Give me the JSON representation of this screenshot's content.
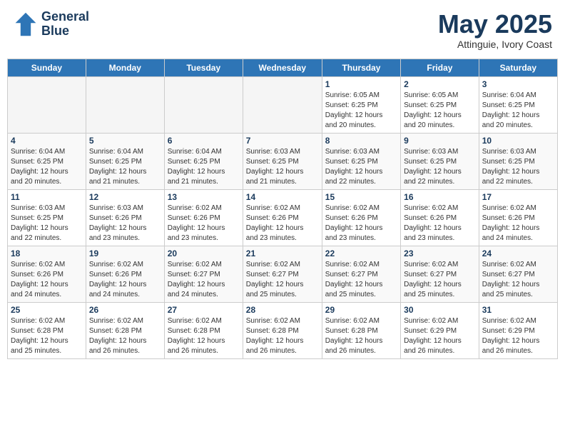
{
  "header": {
    "logo_line1": "General",
    "logo_line2": "Blue",
    "month_title": "May 2025",
    "subtitle": "Attinguie, Ivory Coast"
  },
  "weekdays": [
    "Sunday",
    "Monday",
    "Tuesday",
    "Wednesday",
    "Thursday",
    "Friday",
    "Saturday"
  ],
  "weeks": [
    [
      {
        "day": "",
        "empty": true
      },
      {
        "day": "",
        "empty": true
      },
      {
        "day": "",
        "empty": true
      },
      {
        "day": "",
        "empty": true
      },
      {
        "day": "1",
        "info": "Sunrise: 6:05 AM\nSunset: 6:25 PM\nDaylight: 12 hours\nand 20 minutes."
      },
      {
        "day": "2",
        "info": "Sunrise: 6:05 AM\nSunset: 6:25 PM\nDaylight: 12 hours\nand 20 minutes."
      },
      {
        "day": "3",
        "info": "Sunrise: 6:04 AM\nSunset: 6:25 PM\nDaylight: 12 hours\nand 20 minutes."
      }
    ],
    [
      {
        "day": "4",
        "info": "Sunrise: 6:04 AM\nSunset: 6:25 PM\nDaylight: 12 hours\nand 20 minutes."
      },
      {
        "day": "5",
        "info": "Sunrise: 6:04 AM\nSunset: 6:25 PM\nDaylight: 12 hours\nand 21 minutes."
      },
      {
        "day": "6",
        "info": "Sunrise: 6:04 AM\nSunset: 6:25 PM\nDaylight: 12 hours\nand 21 minutes."
      },
      {
        "day": "7",
        "info": "Sunrise: 6:03 AM\nSunset: 6:25 PM\nDaylight: 12 hours\nand 21 minutes."
      },
      {
        "day": "8",
        "info": "Sunrise: 6:03 AM\nSunset: 6:25 PM\nDaylight: 12 hours\nand 22 minutes."
      },
      {
        "day": "9",
        "info": "Sunrise: 6:03 AM\nSunset: 6:25 PM\nDaylight: 12 hours\nand 22 minutes."
      },
      {
        "day": "10",
        "info": "Sunrise: 6:03 AM\nSunset: 6:25 PM\nDaylight: 12 hours\nand 22 minutes."
      }
    ],
    [
      {
        "day": "11",
        "info": "Sunrise: 6:03 AM\nSunset: 6:25 PM\nDaylight: 12 hours\nand 22 minutes."
      },
      {
        "day": "12",
        "info": "Sunrise: 6:03 AM\nSunset: 6:26 PM\nDaylight: 12 hours\nand 23 minutes."
      },
      {
        "day": "13",
        "info": "Sunrise: 6:02 AM\nSunset: 6:26 PM\nDaylight: 12 hours\nand 23 minutes."
      },
      {
        "day": "14",
        "info": "Sunrise: 6:02 AM\nSunset: 6:26 PM\nDaylight: 12 hours\nand 23 minutes."
      },
      {
        "day": "15",
        "info": "Sunrise: 6:02 AM\nSunset: 6:26 PM\nDaylight: 12 hours\nand 23 minutes."
      },
      {
        "day": "16",
        "info": "Sunrise: 6:02 AM\nSunset: 6:26 PM\nDaylight: 12 hours\nand 23 minutes."
      },
      {
        "day": "17",
        "info": "Sunrise: 6:02 AM\nSunset: 6:26 PM\nDaylight: 12 hours\nand 24 minutes."
      }
    ],
    [
      {
        "day": "18",
        "info": "Sunrise: 6:02 AM\nSunset: 6:26 PM\nDaylight: 12 hours\nand 24 minutes."
      },
      {
        "day": "19",
        "info": "Sunrise: 6:02 AM\nSunset: 6:26 PM\nDaylight: 12 hours\nand 24 minutes."
      },
      {
        "day": "20",
        "info": "Sunrise: 6:02 AM\nSunset: 6:27 PM\nDaylight: 12 hours\nand 24 minutes."
      },
      {
        "day": "21",
        "info": "Sunrise: 6:02 AM\nSunset: 6:27 PM\nDaylight: 12 hours\nand 25 minutes."
      },
      {
        "day": "22",
        "info": "Sunrise: 6:02 AM\nSunset: 6:27 PM\nDaylight: 12 hours\nand 25 minutes."
      },
      {
        "day": "23",
        "info": "Sunrise: 6:02 AM\nSunset: 6:27 PM\nDaylight: 12 hours\nand 25 minutes."
      },
      {
        "day": "24",
        "info": "Sunrise: 6:02 AM\nSunset: 6:27 PM\nDaylight: 12 hours\nand 25 minutes."
      }
    ],
    [
      {
        "day": "25",
        "info": "Sunrise: 6:02 AM\nSunset: 6:28 PM\nDaylight: 12 hours\nand 25 minutes."
      },
      {
        "day": "26",
        "info": "Sunrise: 6:02 AM\nSunset: 6:28 PM\nDaylight: 12 hours\nand 26 minutes."
      },
      {
        "day": "27",
        "info": "Sunrise: 6:02 AM\nSunset: 6:28 PM\nDaylight: 12 hours\nand 26 minutes."
      },
      {
        "day": "28",
        "info": "Sunrise: 6:02 AM\nSunset: 6:28 PM\nDaylight: 12 hours\nand 26 minutes."
      },
      {
        "day": "29",
        "info": "Sunrise: 6:02 AM\nSunset: 6:28 PM\nDaylight: 12 hours\nand 26 minutes."
      },
      {
        "day": "30",
        "info": "Sunrise: 6:02 AM\nSunset: 6:29 PM\nDaylight: 12 hours\nand 26 minutes."
      },
      {
        "day": "31",
        "info": "Sunrise: 6:02 AM\nSunset: 6:29 PM\nDaylight: 12 hours\nand 26 minutes."
      }
    ]
  ]
}
